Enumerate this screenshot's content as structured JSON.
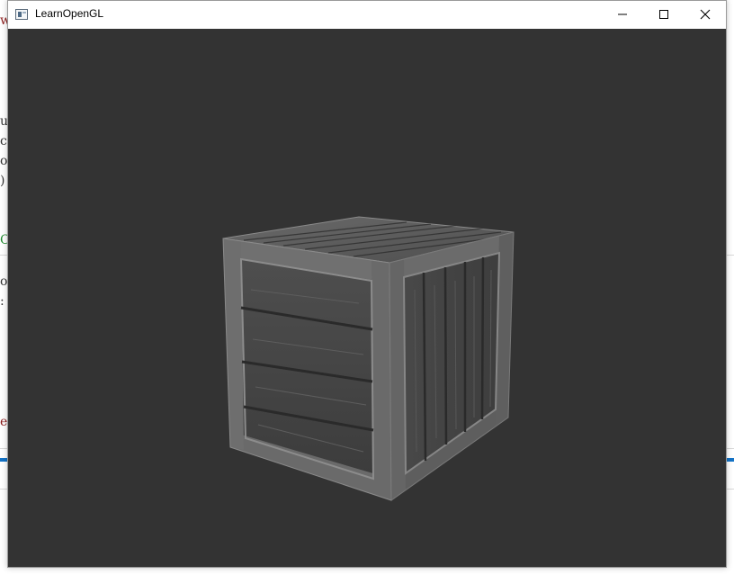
{
  "window": {
    "title": "LearnOpenGL"
  },
  "background_window": {
    "glyphs": [
      {
        "text": "w",
        "color": "#8b1a1a"
      },
      {
        "text": "u",
        "color": "#333333"
      },
      {
        "text": "c",
        "color": "#333333"
      },
      {
        "text": "o",
        "color": "#333333"
      },
      {
        "text": ")",
        "color": "#333333"
      },
      {
        "text": "C",
        "color": "#1e8a2e"
      },
      {
        "text": "o",
        "color": "#333333"
      },
      {
        "text": ":",
        "color": "#333333"
      },
      {
        "text": "e",
        "color": "#8b1a1a"
      }
    ]
  },
  "scene": {
    "background_color": "#333333",
    "object": "wooden-crate"
  },
  "icons": {
    "app": "app-window-icon",
    "minimize": "minimize-icon",
    "maximize": "maximize-icon",
    "close": "close-icon"
  }
}
